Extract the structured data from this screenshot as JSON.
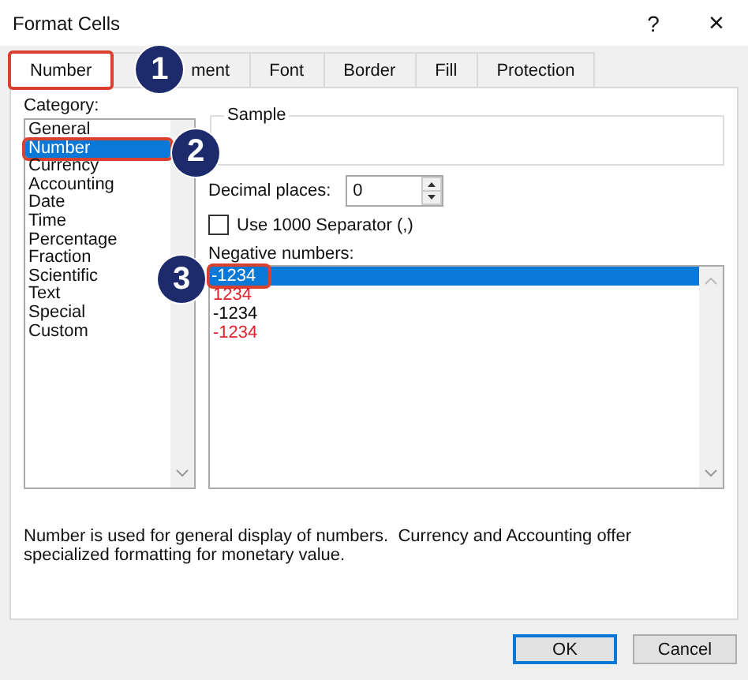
{
  "window": {
    "title": "Format Cells",
    "help": "?",
    "close": "×"
  },
  "tabs": [
    {
      "label": "Number",
      "selected": true,
      "callout": "1"
    },
    {
      "label": "ment",
      "selected": false
    },
    {
      "label": "Font",
      "selected": false
    },
    {
      "label": "Border",
      "selected": false
    },
    {
      "label": "Fill",
      "selected": false
    },
    {
      "label": "Protection",
      "selected": false
    }
  ],
  "category": {
    "label": "Category:",
    "items": [
      {
        "label": "General",
        "selected": false
      },
      {
        "label": "Number",
        "selected": true,
        "callout": "2"
      },
      {
        "label": "Currency",
        "selected": false
      },
      {
        "label": "Accounting",
        "selected": false
      },
      {
        "label": "Date",
        "selected": false
      },
      {
        "label": "Time",
        "selected": false
      },
      {
        "label": "Percentage",
        "selected": false
      },
      {
        "label": "Fraction",
        "selected": false
      },
      {
        "label": "Scientific",
        "selected": false
      },
      {
        "label": "Text",
        "selected": false
      },
      {
        "label": "Special",
        "selected": false
      },
      {
        "label": "Custom",
        "selected": false
      }
    ]
  },
  "sample": {
    "label": "Sample"
  },
  "decimal_places": {
    "label": "Decimal places:",
    "value": "0"
  },
  "separator": {
    "label": "Use 1000 Separator (,)",
    "checked": false
  },
  "negative_numbers": {
    "label": "Negative numbers:",
    "items": [
      {
        "label": "-1234",
        "selected": true,
        "callout": "3"
      },
      {
        "label": "1234",
        "selected": false,
        "color": "#e0202a"
      },
      {
        "label": "-1234",
        "selected": false,
        "color": "#000000"
      },
      {
        "label": "-1234",
        "selected": false,
        "color": "#e0202a"
      }
    ]
  },
  "description": "Number is used for general display of numbers.  Currency and Accounting offer specialized formatting for monetary value.",
  "buttons": [
    {
      "label": "OK",
      "default": true
    },
    {
      "label": "Cancel",
      "default": false
    }
  ]
}
